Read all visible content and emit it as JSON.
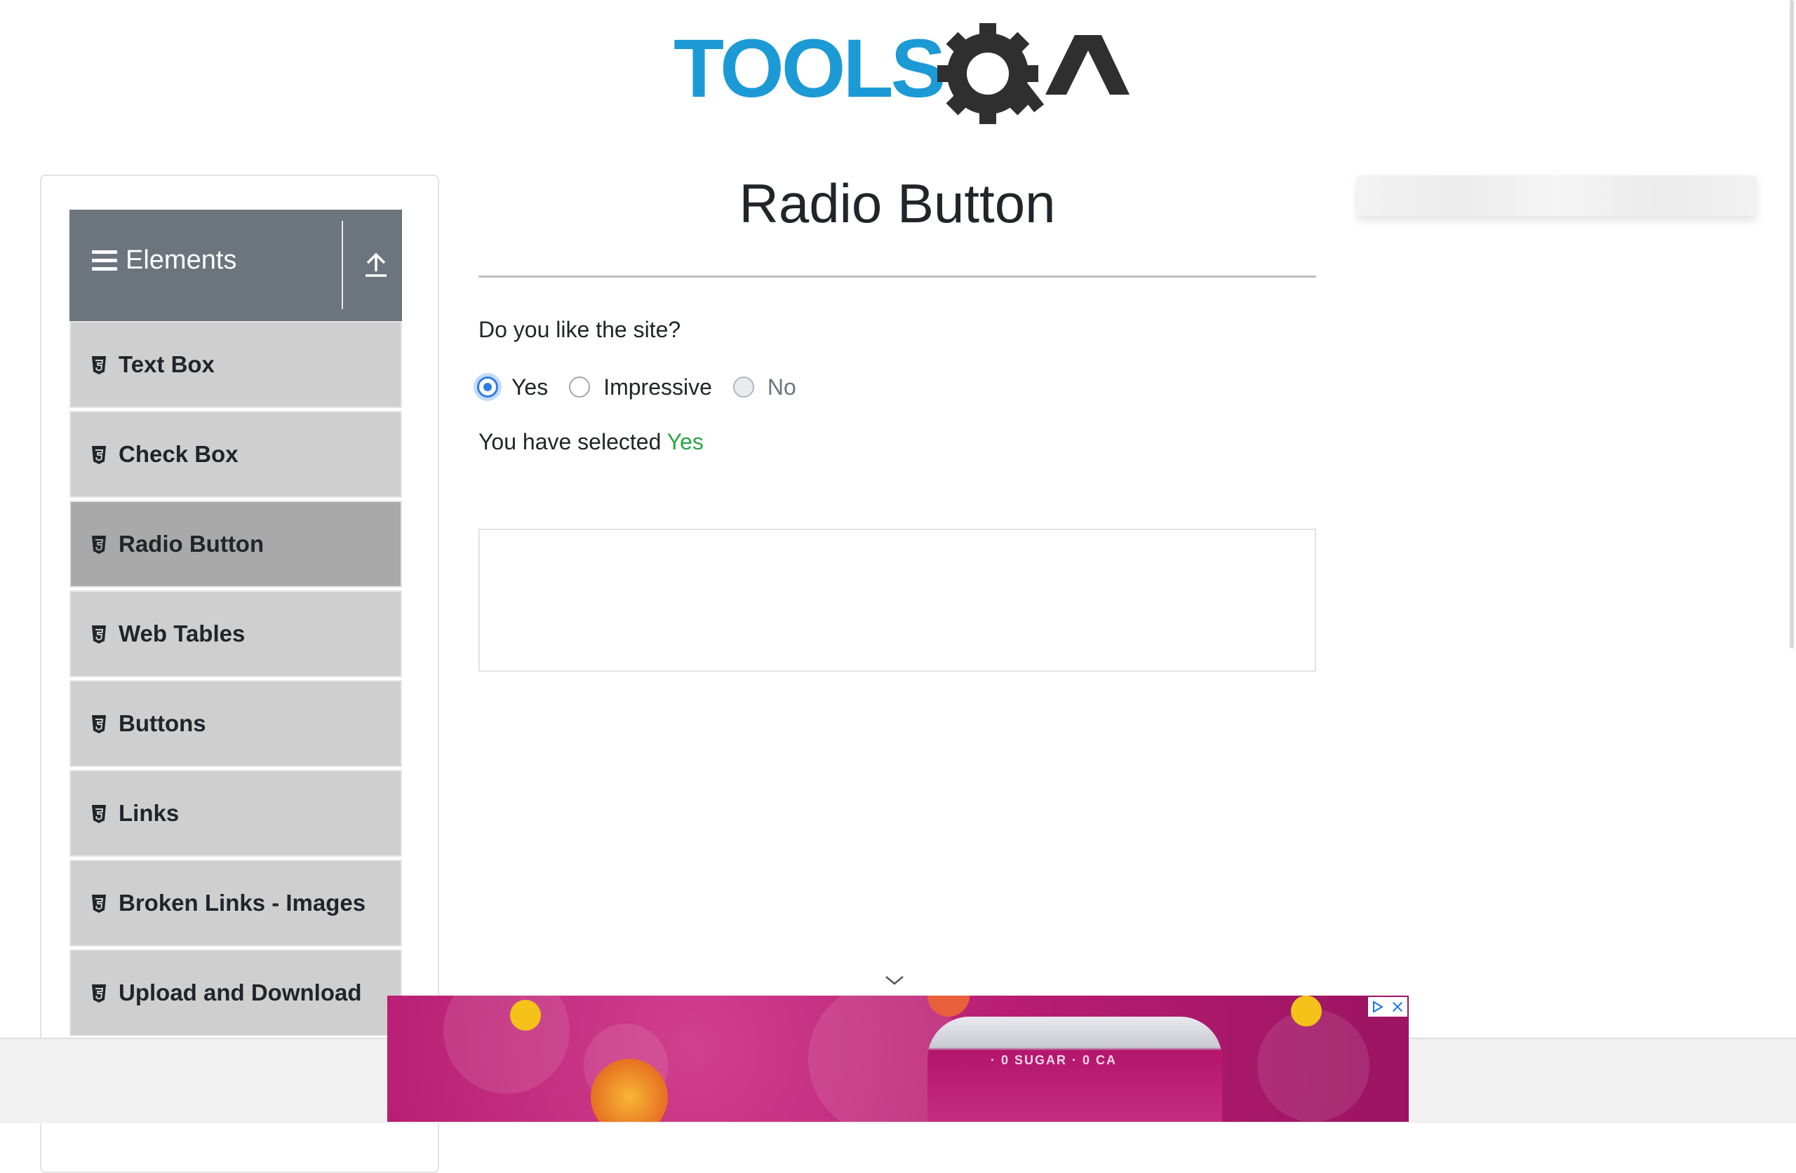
{
  "logo": {
    "text_tools": "TOOLS",
    "text_qa": "QA",
    "colors": {
      "blue": "#1b9ad6",
      "dark": "#2f2f2f"
    }
  },
  "sidebar": {
    "group_title": "Elements",
    "items": [
      {
        "label": "Text Box",
        "active": false
      },
      {
        "label": "Check Box",
        "active": false
      },
      {
        "label": "Radio Button",
        "active": true
      },
      {
        "label": "Web Tables",
        "active": false
      },
      {
        "label": "Buttons",
        "active": false
      },
      {
        "label": "Links",
        "active": false
      },
      {
        "label": "Broken Links - Images",
        "active": false
      },
      {
        "label": "Upload and Download",
        "active": false
      }
    ]
  },
  "main": {
    "title": "Radio Button",
    "question": "Do you like the site?",
    "options": [
      {
        "label": "Yes",
        "checked": true,
        "disabled": false
      },
      {
        "label": "Impressive",
        "checked": false,
        "disabled": false
      },
      {
        "label": "No",
        "checked": false,
        "disabled": true
      }
    ],
    "result_prefix": "You have selected",
    "result_value": "Yes"
  },
  "ad": {
    "can_text": "· 0 SUGAR · 0 CA",
    "accent_color": "#b81d72"
  },
  "icons": {
    "menu_icon": "hamburger-icon",
    "collapse_icon": "upload-arrow-icon",
    "item_icon": "html5-shield-icon",
    "ad_choices": "adchoices-icon",
    "ad_close": "close-icon",
    "expand": "chevron-down-icon"
  }
}
